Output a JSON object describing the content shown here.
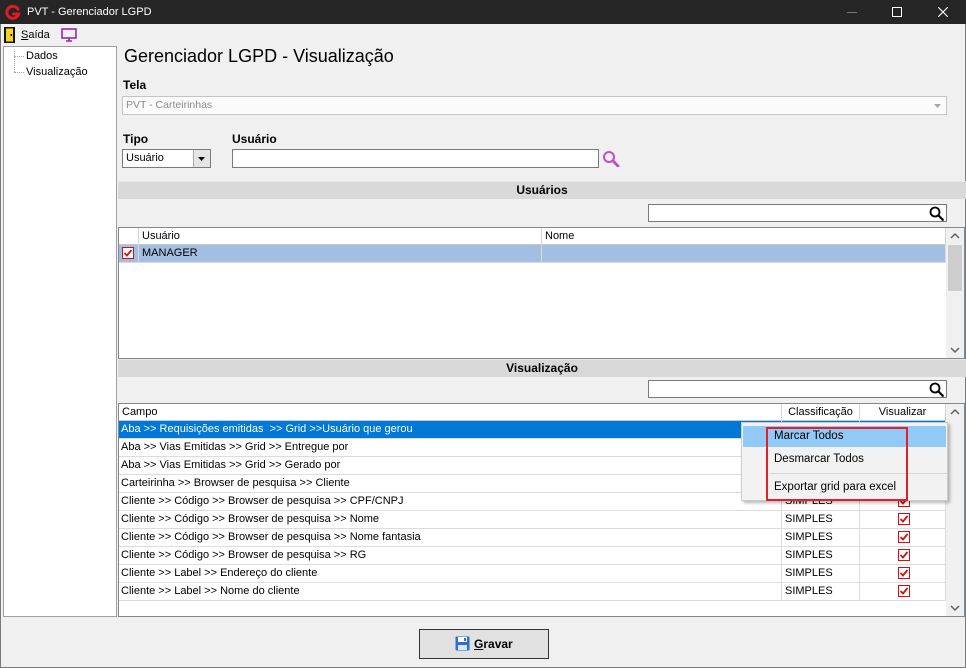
{
  "window": {
    "title": "PVT - Gerenciador LGPD"
  },
  "toolbar": {
    "exit_label": "Saída"
  },
  "tree": {
    "items": [
      "Dados",
      "Visualização"
    ]
  },
  "page": {
    "title": "Gerenciador LGPD - Visualização"
  },
  "form": {
    "tela_label": "Tela",
    "tela_value": "PVT - Carteirinhas",
    "tipo_label": "Tipo",
    "tipo_value": "Usuário",
    "usuario_label": "Usuário"
  },
  "usuarios": {
    "section_title": "Usuários",
    "columns": {
      "usuario": "Usuário",
      "nome": "Nome"
    },
    "rows": [
      {
        "checked": true,
        "selected": true,
        "usuario": "MANAGER"
      }
    ]
  },
  "visualizacao": {
    "section_title": "Visualização",
    "columns": {
      "campo": "Campo",
      "classificacao": "Classificação",
      "visualizar": "Visualizar"
    },
    "rows": [
      {
        "campo": "Aba >> Requisições emitidas  >> Grid >>Usuário que gerou",
        "selected": true
      },
      {
        "campo": "Aba >> Vias Emitidas >> Grid >> Entregue por"
      },
      {
        "campo": "Aba >> Vias Emitidas >> Grid >> Gerado por"
      },
      {
        "campo": "Carteirinha >> Browser de pesquisa >> Cliente"
      },
      {
        "campo": "Cliente >> Código >> Browser de pesquisa >> CPF/CNPJ",
        "classificacao": "SIMPLES",
        "visualizar": true
      },
      {
        "campo": "Cliente >> Código >> Browser de pesquisa >> Nome",
        "classificacao": "SIMPLES",
        "visualizar": true
      },
      {
        "campo": "Cliente >> Código >> Browser de pesquisa >> Nome fantasia",
        "classificacao": "SIMPLES",
        "visualizar": true
      },
      {
        "campo": "Cliente >> Código >> Browser de pesquisa >> RG",
        "classificacao": "SIMPLES",
        "visualizar": true
      },
      {
        "campo": "Cliente >> Label >> Endereço do cliente",
        "classificacao": "SIMPLES",
        "visualizar": true
      },
      {
        "campo": "Cliente >> Label >> Nome do cliente",
        "classificacao": "SIMPLES",
        "visualizar": true
      }
    ]
  },
  "context_menu": {
    "items": [
      {
        "label": "Marcar Todos",
        "highlighted": true
      },
      {
        "label": "Desmarcar Todos"
      },
      {
        "label": "Exportar grid para excel"
      }
    ]
  },
  "footer": {
    "save_label": "Gravar"
  },
  "icons": {
    "app": "app-logo-icon",
    "exit": "exit-door-icon",
    "display": "monitor-icon",
    "user_lookup": "search-icon",
    "filter": "search-icon",
    "save": "floppy-save-icon"
  },
  "colors": {
    "selection": "#0078d7",
    "selection_inactive": "#a3bde3",
    "menu_highlight": "#91c9f7",
    "annotation": "#e0202a",
    "checkbox": "#d01010",
    "lookup_accent": "#c04ccc"
  }
}
